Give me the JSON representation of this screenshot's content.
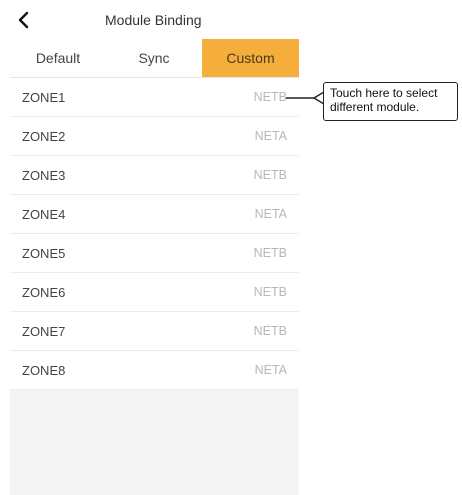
{
  "header": {
    "title": "Module Binding",
    "back_icon": "chevron-left-icon"
  },
  "tabs": [
    {
      "label": "Default",
      "active": false
    },
    {
      "label": "Sync",
      "active": false
    },
    {
      "label": "Custom",
      "active": true
    }
  ],
  "zones": [
    {
      "name": "ZONE1",
      "module": "NETB"
    },
    {
      "name": "ZONE2",
      "module": "NETA"
    },
    {
      "name": "ZONE3",
      "module": "NETB"
    },
    {
      "name": "ZONE4",
      "module": "NETA"
    },
    {
      "name": "ZONE5",
      "module": "NETB"
    },
    {
      "name": "ZONE6",
      "module": "NETB"
    },
    {
      "name": "ZONE7",
      "module": "NETB"
    },
    {
      "name": "ZONE8",
      "module": "NETA"
    }
  ],
  "callout": {
    "line1": "Touch here to select",
    "line2": "different module."
  },
  "colors": {
    "accent": "#f5ae3c",
    "module_text": "#b8b8b8",
    "list_background": "#f4f4f4"
  }
}
